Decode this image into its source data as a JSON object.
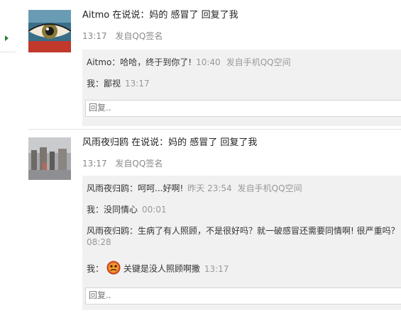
{
  "feed": [
    {
      "status_line": "Aitmo 在说说：妈的 感冒了 回复了我",
      "time": "13:17",
      "source": "发自QQ签名",
      "replies": [
        {
          "text": "Aitmo：哈哈，终于到你了!",
          "time": "10:40",
          "source": "发自手机QQ空间"
        },
        {
          "text": "我：鄙视",
          "time": "13:17"
        }
      ],
      "reply_placeholder": "回复.."
    },
    {
      "status_line": "风雨夜归鸥 在说说：妈的 感冒了 回复了我",
      "time": "13:17",
      "source": "发自QQ签名",
      "replies": [
        {
          "text": "风雨夜归鸥：呵呵...好啊!",
          "time": "昨天 23:54",
          "source": "发自手机QQ空间"
        },
        {
          "text": "我：没同情心",
          "time": "00:01"
        },
        {
          "text": "风雨夜归鸥：生病了有人照顾，不是很好吗？就一破感冒还需要同情啊! 很严重吗？",
          "time": "08:28"
        },
        {
          "prefix": "我：",
          "text": "关键是没人照顾啊撒",
          "time": "13:17",
          "emoji": "sad-face-icon"
        }
      ],
      "reply_placeholder": "回复.."
    }
  ]
}
